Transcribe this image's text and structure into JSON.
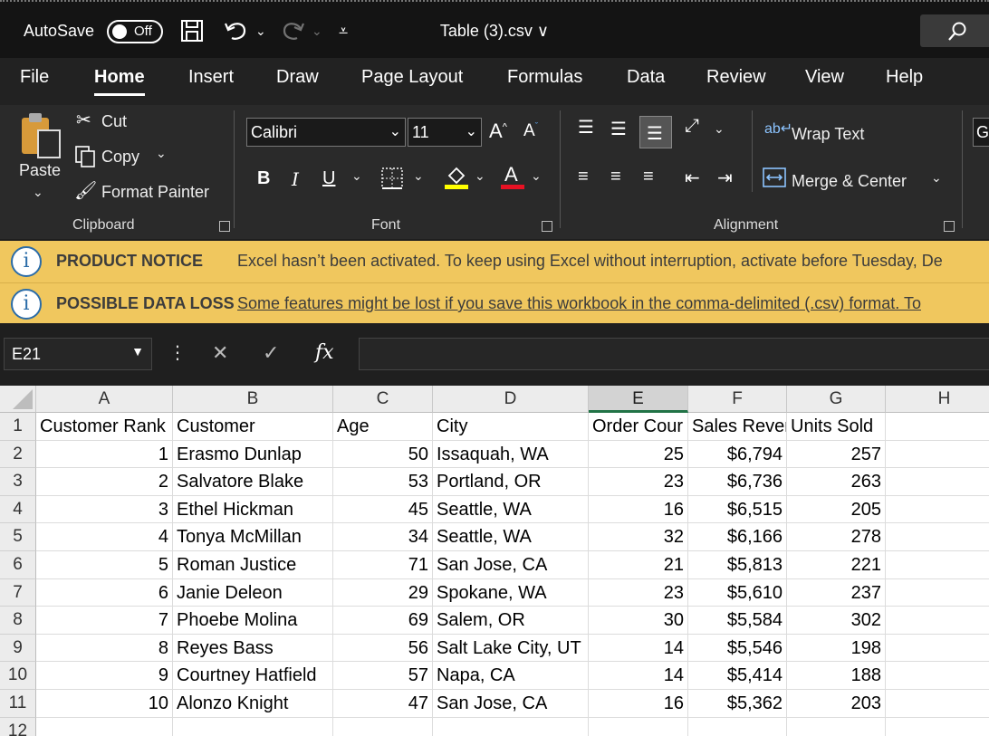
{
  "titlebar": {
    "autosave_label": "AutoSave",
    "autosave_state": "Off",
    "document_title": "Table (3).csv ∨"
  },
  "tabs": [
    "File",
    "Home",
    "Insert",
    "Draw",
    "Page Layout",
    "Formulas",
    "Data",
    "Review",
    "View",
    "Help"
  ],
  "active_tab": "Home",
  "ribbon": {
    "clipboard": {
      "paste": "Paste",
      "cut": "Cut",
      "copy": "Copy",
      "format_painter": "Format Painter",
      "label": "Clipboard"
    },
    "font": {
      "font_name": "Calibri",
      "font_size": "11",
      "bold": "B",
      "italic": "I",
      "underline": "U",
      "label": "Font",
      "highlight_color": "#ffff00",
      "font_color": "#e81123"
    },
    "alignment": {
      "wrap_text": "Wrap Text",
      "merge_center": "Merge & Center",
      "label": "Alignment"
    },
    "number_format_partial": "G"
  },
  "notices": [
    {
      "title": "PRODUCT NOTICE",
      "message": "Excel hasn’t been activated. To keep using Excel without interruption, activate before Tuesday, De"
    },
    {
      "title": "POSSIBLE DATA LOSS",
      "message": "Some features might be lost if you save this workbook in the comma-delimited (.csv) format. To"
    }
  ],
  "formula_bar": {
    "name_box": "E21",
    "fx": "fx",
    "formula": ""
  },
  "columns": [
    "A",
    "B",
    "C",
    "D",
    "E",
    "F",
    "G",
    "H"
  ],
  "selected_column": "E",
  "rows": [
    "1",
    "2",
    "3",
    "4",
    "5",
    "6",
    "7",
    "8",
    "9",
    "10",
    "11",
    "12"
  ],
  "headers": [
    "Customer Rank",
    "Customer",
    "Age",
    "City",
    "Order Cour",
    "Sales Rever",
    "Units Sold"
  ],
  "data": [
    [
      "1",
      "Erasmo Dunlap",
      "50",
      "Issaquah, WA",
      "25",
      "$6,794",
      "257"
    ],
    [
      "2",
      "Salvatore Blake",
      "53",
      "Portland, OR",
      "23",
      "$6,736",
      "263"
    ],
    [
      "3",
      "Ethel Hickman",
      "45",
      "Seattle, WA",
      "16",
      "$6,515",
      "205"
    ],
    [
      "4",
      "Tonya McMillan",
      "34",
      "Seattle, WA",
      "32",
      "$6,166",
      "278"
    ],
    [
      "5",
      "Roman Justice",
      "71",
      "San Jose, CA",
      "21",
      "$5,813",
      "221"
    ],
    [
      "6",
      "Janie Deleon",
      "29",
      "Spokane, WA",
      "23",
      "$5,610",
      "237"
    ],
    [
      "7",
      "Phoebe Molina",
      "69",
      "Salem, OR",
      "30",
      "$5,584",
      "302"
    ],
    [
      "8",
      "Reyes Bass",
      "56",
      "Salt Lake City, UT",
      "14",
      "$5,546",
      "198"
    ],
    [
      "9",
      "Courtney Hatfield",
      "57",
      "Napa, CA",
      "14",
      "$5,414",
      "188"
    ],
    [
      "10",
      "Alonzo Knight",
      "47",
      "San Jose, CA",
      "16",
      "$5,362",
      "203"
    ]
  ],
  "colors": {
    "notice_bg": "#f0c75e",
    "excel_green": "#217346"
  }
}
